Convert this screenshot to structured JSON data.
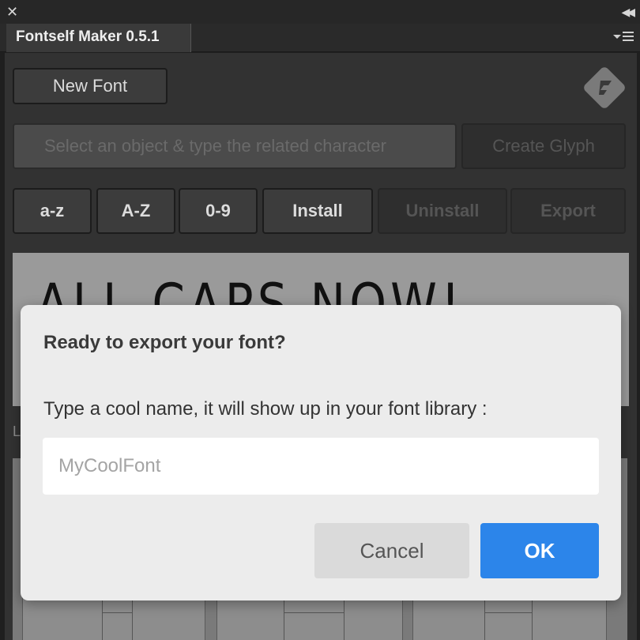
{
  "window": {
    "close_glyph": "✕",
    "collapse_glyph": "◀◀",
    "tab_title": "Fontself Maker 0.5.1"
  },
  "toolbar": {
    "new_font_label": "New Font",
    "select_hint": "Select an object & type the related character",
    "create_glyph_label": "Create Glyph",
    "az_lower_label": "a-z",
    "az_upper_label": "A-Z",
    "digits_label": "0-9",
    "install_label": "Install",
    "uninstall_label": "Uninstall",
    "export_label": "Export"
  },
  "preview": {
    "text": "ALL CAPS NOW!"
  },
  "lower": {
    "label_fragment": "L"
  },
  "dialog": {
    "title": "Ready to export your font?",
    "description": "Type a cool name, it will show up in your font library :",
    "input_placeholder": "MyCoolFont",
    "input_value": "",
    "cancel_label": "Cancel",
    "ok_label": "OK"
  },
  "colors": {
    "accent": "#2c85ea",
    "panel_bg": "#323232",
    "dialog_bg": "#ececec"
  },
  "icons": [
    "close-icon",
    "collapse-icon",
    "panel-menu-icon",
    "fontself-logo-icon"
  ]
}
